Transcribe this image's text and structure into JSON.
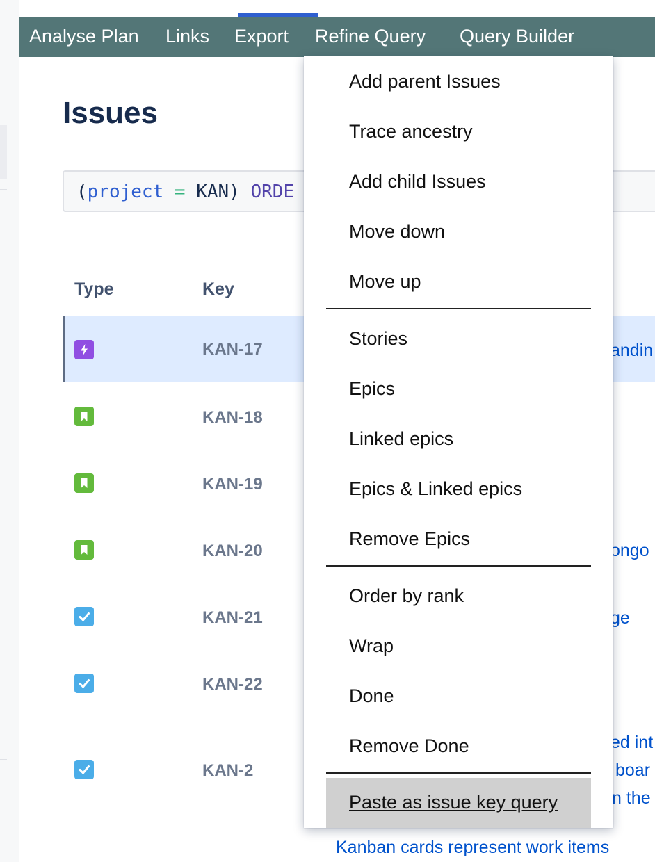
{
  "toolbar": {
    "items": [
      "Analyse Plan",
      "Links",
      "Export",
      "Refine Query",
      "Query Builder"
    ]
  },
  "page": {
    "title": "Issues"
  },
  "query": {
    "open_paren": "(",
    "field": "project",
    "operator": "=",
    "value": "KAN)",
    "order": "ORDE"
  },
  "table": {
    "headers": [
      "Type",
      "Key"
    ],
    "rows": [
      {
        "type": "epic-icon",
        "key": "KAN-17"
      },
      {
        "type": "story-icon",
        "key": "KAN-18"
      },
      {
        "type": "story-icon",
        "key": "KAN-19"
      },
      {
        "type": "story-icon",
        "key": "KAN-20"
      },
      {
        "type": "task-icon",
        "key": "KAN-21"
      },
      {
        "type": "task-icon",
        "key": "KAN-22"
      },
      {
        "type": "task-icon",
        "key": "KAN-2"
      }
    ],
    "summary_fragments": {
      "kan17": "andin",
      "kan20": "ongo",
      "kan21": "ge",
      "kan2_line1": "ed int",
      "kan2_line2": "boar",
      "kan2_line3": "n the",
      "last_line": "Kanban cards represent work items"
    }
  },
  "menu": {
    "group1": [
      "Add parent Issues",
      "Trace ancestry",
      "Add child Issues",
      "Move down",
      "Move up"
    ],
    "group2": [
      "Stories",
      "Epics",
      "Linked epics",
      "Epics & Linked epics",
      "Remove Epics"
    ],
    "group3": [
      "Order by rank",
      "Wrap",
      "Done",
      "Remove Done"
    ],
    "highlighted": "Paste as issue key query"
  },
  "colors": {
    "toolbar_bg": "#537677",
    "accent": "#2f5fd0",
    "epic": "#904ee2",
    "story": "#63ba3c",
    "task": "#4bade8",
    "link": "#0052cc"
  }
}
